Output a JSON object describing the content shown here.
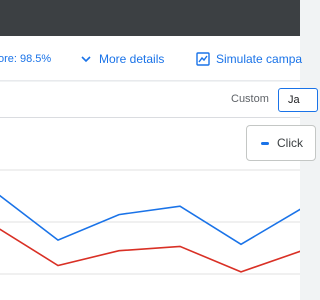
{
  "toolbar": {
    "score_text": "ore: 98.5%",
    "more_details_label": "More details",
    "simulate_label": "Simulate campa"
  },
  "date_range": {
    "label": "Custom",
    "start_value": "Ja"
  },
  "chart": {
    "metric_chip_label": "Click",
    "colors": {
      "blue": "#1a73e8",
      "red": "#d93025",
      "grid": "#e0e0e0"
    }
  },
  "chart_data": {
    "type": "line",
    "series": [
      {
        "values": [
          0.76,
          0.32,
          0.56,
          0.64,
          0.28,
          0.62
        ]
      },
      {
        "values": [
          0.44,
          0.08,
          0.22,
          0.26,
          0.02,
          0.22
        ]
      }
    ],
    "ylim": [
      0,
      1
    ],
    "grid": true
  }
}
